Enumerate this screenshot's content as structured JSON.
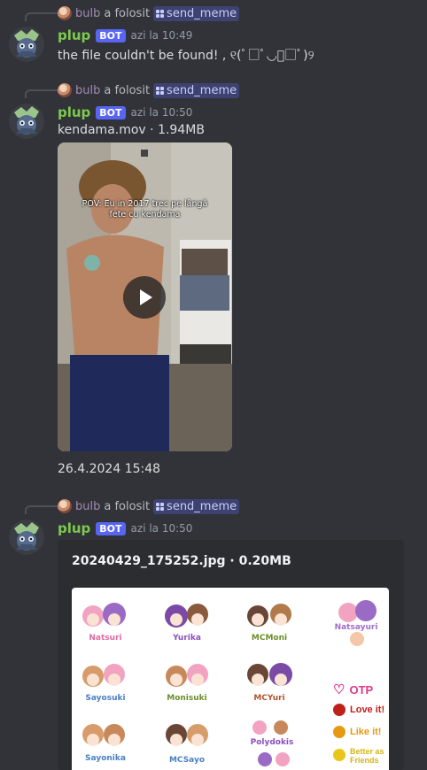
{
  "messages": [
    {
      "reply_user": "bulb",
      "reply_verb": "a folosit",
      "reply_command": "send_meme",
      "username": "plup",
      "badge": "BOT",
      "time": "azi la 10:49",
      "content": "the file couldn't be found! , ୧(ﾟ□ﾟ◡ﾟ□ﾟ)୨"
    },
    {
      "reply_user": "bulb",
      "reply_verb": "a folosit",
      "reply_command": "send_meme",
      "username": "plup",
      "badge": "BOT",
      "time": "azi la 10:50",
      "content": "kendama.mov · 1.94MB",
      "video_caption_line1": "POV: Eu in 2017 trec pe lângă",
      "video_caption_line2": "fete cu kendama",
      "date_text": "26.4.2024 15:48"
    },
    {
      "reply_user": "bulb",
      "reply_verb": "a folosit",
      "reply_command": "send_meme",
      "username": "plup",
      "badge": "BOT",
      "time": "azi la 10:50",
      "embed_title": "20240429_175252.jpg · 0.20MB",
      "stickers": [
        "Natsuri",
        "Yurika",
        "MCMoni",
        "Natsayuri",
        "Sayosuki",
        "Monisuki",
        "MCYuri",
        "Sayonika",
        "MCSayo",
        "Polydokis"
      ],
      "legend": [
        "OTP",
        "Love it!",
        "Like it!",
        "Better as Friends"
      ]
    }
  ],
  "colors": {
    "background": "#313338",
    "username": "#7cc94f",
    "badge": "#5865f2",
    "command": "#c9cdfb",
    "embed": "#2b2d31"
  }
}
